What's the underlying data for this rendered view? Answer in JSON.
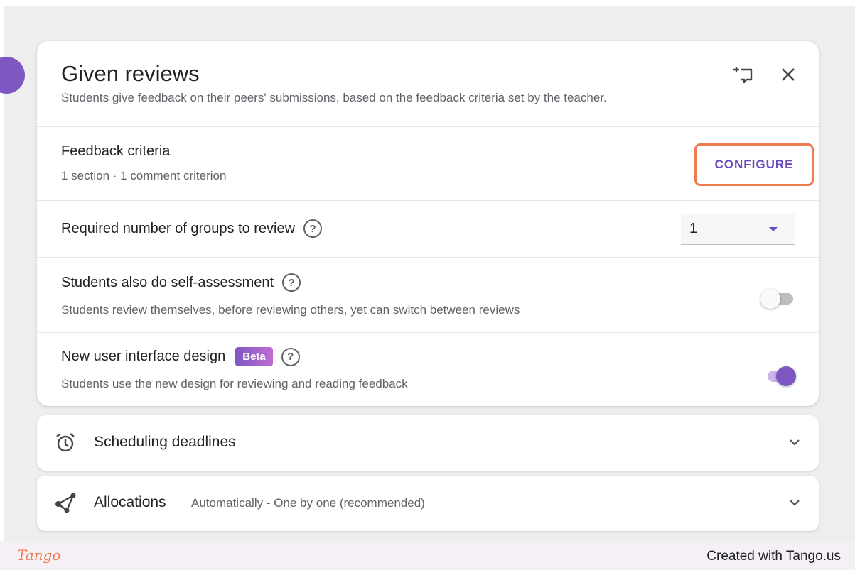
{
  "header": {
    "title": "Given reviews",
    "subtitle": "Students give feedback on their peers' submissions, based on the feedback criteria set by the teacher.",
    "icons": [
      "add-to-collection-icon",
      "close-icon"
    ]
  },
  "feedback_criteria": {
    "title": "Feedback criteria",
    "summary": "1 section · 1 comment criterion",
    "configure_label": "CONFIGURE"
  },
  "required_groups": {
    "label": "Required number of groups to review",
    "value": "1",
    "help_glyph": "?"
  },
  "self_assessment": {
    "title": "Students also do self-assessment",
    "description": "Students review themselves, before reviewing others, yet can switch between reviews",
    "enabled": false,
    "help_glyph": "?"
  },
  "new_ui": {
    "title": "New user interface design",
    "badge": "Beta",
    "description": "Students use the new design for reviewing and reading feedback",
    "enabled": true,
    "help_glyph": "?"
  },
  "panels": {
    "scheduling": {
      "title": "Scheduling deadlines",
      "icon": "alarm-clock-icon"
    },
    "allocations": {
      "title": "Allocations",
      "subtitle": "Automatically - One by one (recommended)",
      "icon": "allocation-icon"
    }
  },
  "footer": {
    "logo": "Tango",
    "credit": "Created with Tango.us"
  },
  "colors": {
    "accent": "#7e57c2",
    "highlight": "#f07a4f",
    "text": "#212121",
    "muted": "#5f6368"
  }
}
